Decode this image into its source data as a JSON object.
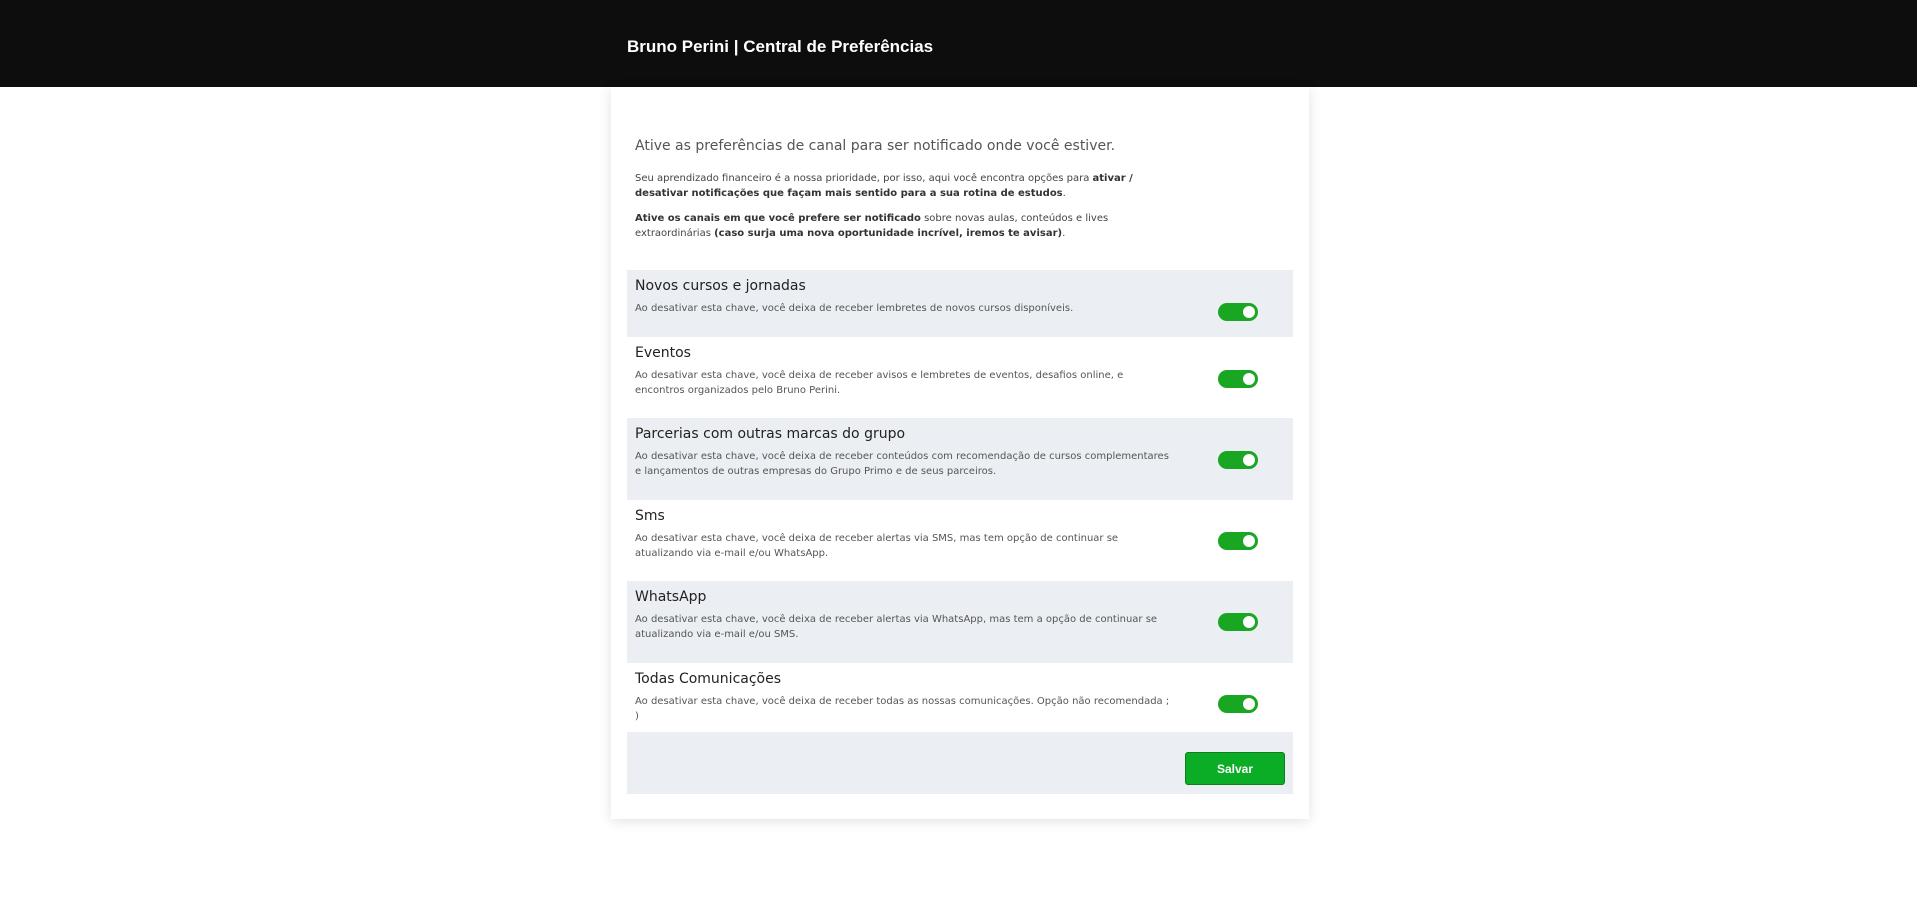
{
  "header": {
    "title": "Bruno Perini | Central de Preferências"
  },
  "intro": {
    "headline": "Ative as preferências de canal para ser notificado onde você estiver.",
    "p1_a": "Seu aprendizado financeiro é a nossa prioridade, por isso, aqui você encontra opções para ",
    "p1_b": "ativar / desativar notificações que façam mais sentido para a sua rotina de estudos",
    "p1_c": ".",
    "p2_a": "Ative os canais em que você prefere ser notificado",
    "p2_b": " sobre novas aulas, conteúdos e lives extraordinárias ",
    "p2_c": "(caso surja uma nova oportunidade incrível, iremos te avisar)",
    "p2_d": "."
  },
  "preferences": [
    {
      "title": "Novos cursos e jornadas",
      "description": "Ao desativar esta chave, você deixa de receber lembretes de novos cursos disponíveis.",
      "enabled": true
    },
    {
      "title": "Eventos",
      "description": "Ao desativar esta chave, você deixa de receber avisos e lembretes de eventos, desafios online, e encontros organizados pelo Bruno Perini.",
      "enabled": true
    },
    {
      "title": "Parcerias com outras marcas do grupo",
      "description": "Ao desativar esta chave, você deixa de receber conteúdos com recomendação de cursos complementares e lançamentos de outras empresas do Grupo Primo e de seus parceiros.",
      "enabled": true
    },
    {
      "title": "Sms",
      "description": "Ao desativar esta chave, você deixa de receber alertas via SMS, mas tem opção de continuar se atualizando via e-mail e/ou WhatsApp.",
      "enabled": true
    },
    {
      "title": "WhatsApp",
      "description": "Ao desativar esta chave, você deixa de receber alertas via WhatsApp, mas tem a opção de continuar se atualizando via e-mail e/ou SMS.",
      "enabled": true
    },
    {
      "title": "Todas Comunicações",
      "description": "Ao desativar esta chave, você deixa de receber todas as nossas comunicações. Opção não recomendada ; )",
      "enabled": true
    }
  ],
  "footer": {
    "save_label": "Salvar"
  },
  "colors": {
    "topbar": "#0d0d0d",
    "toggle_on": "#18a623",
    "save_button": "#0aad25",
    "row_alt": "#ebeef3"
  }
}
